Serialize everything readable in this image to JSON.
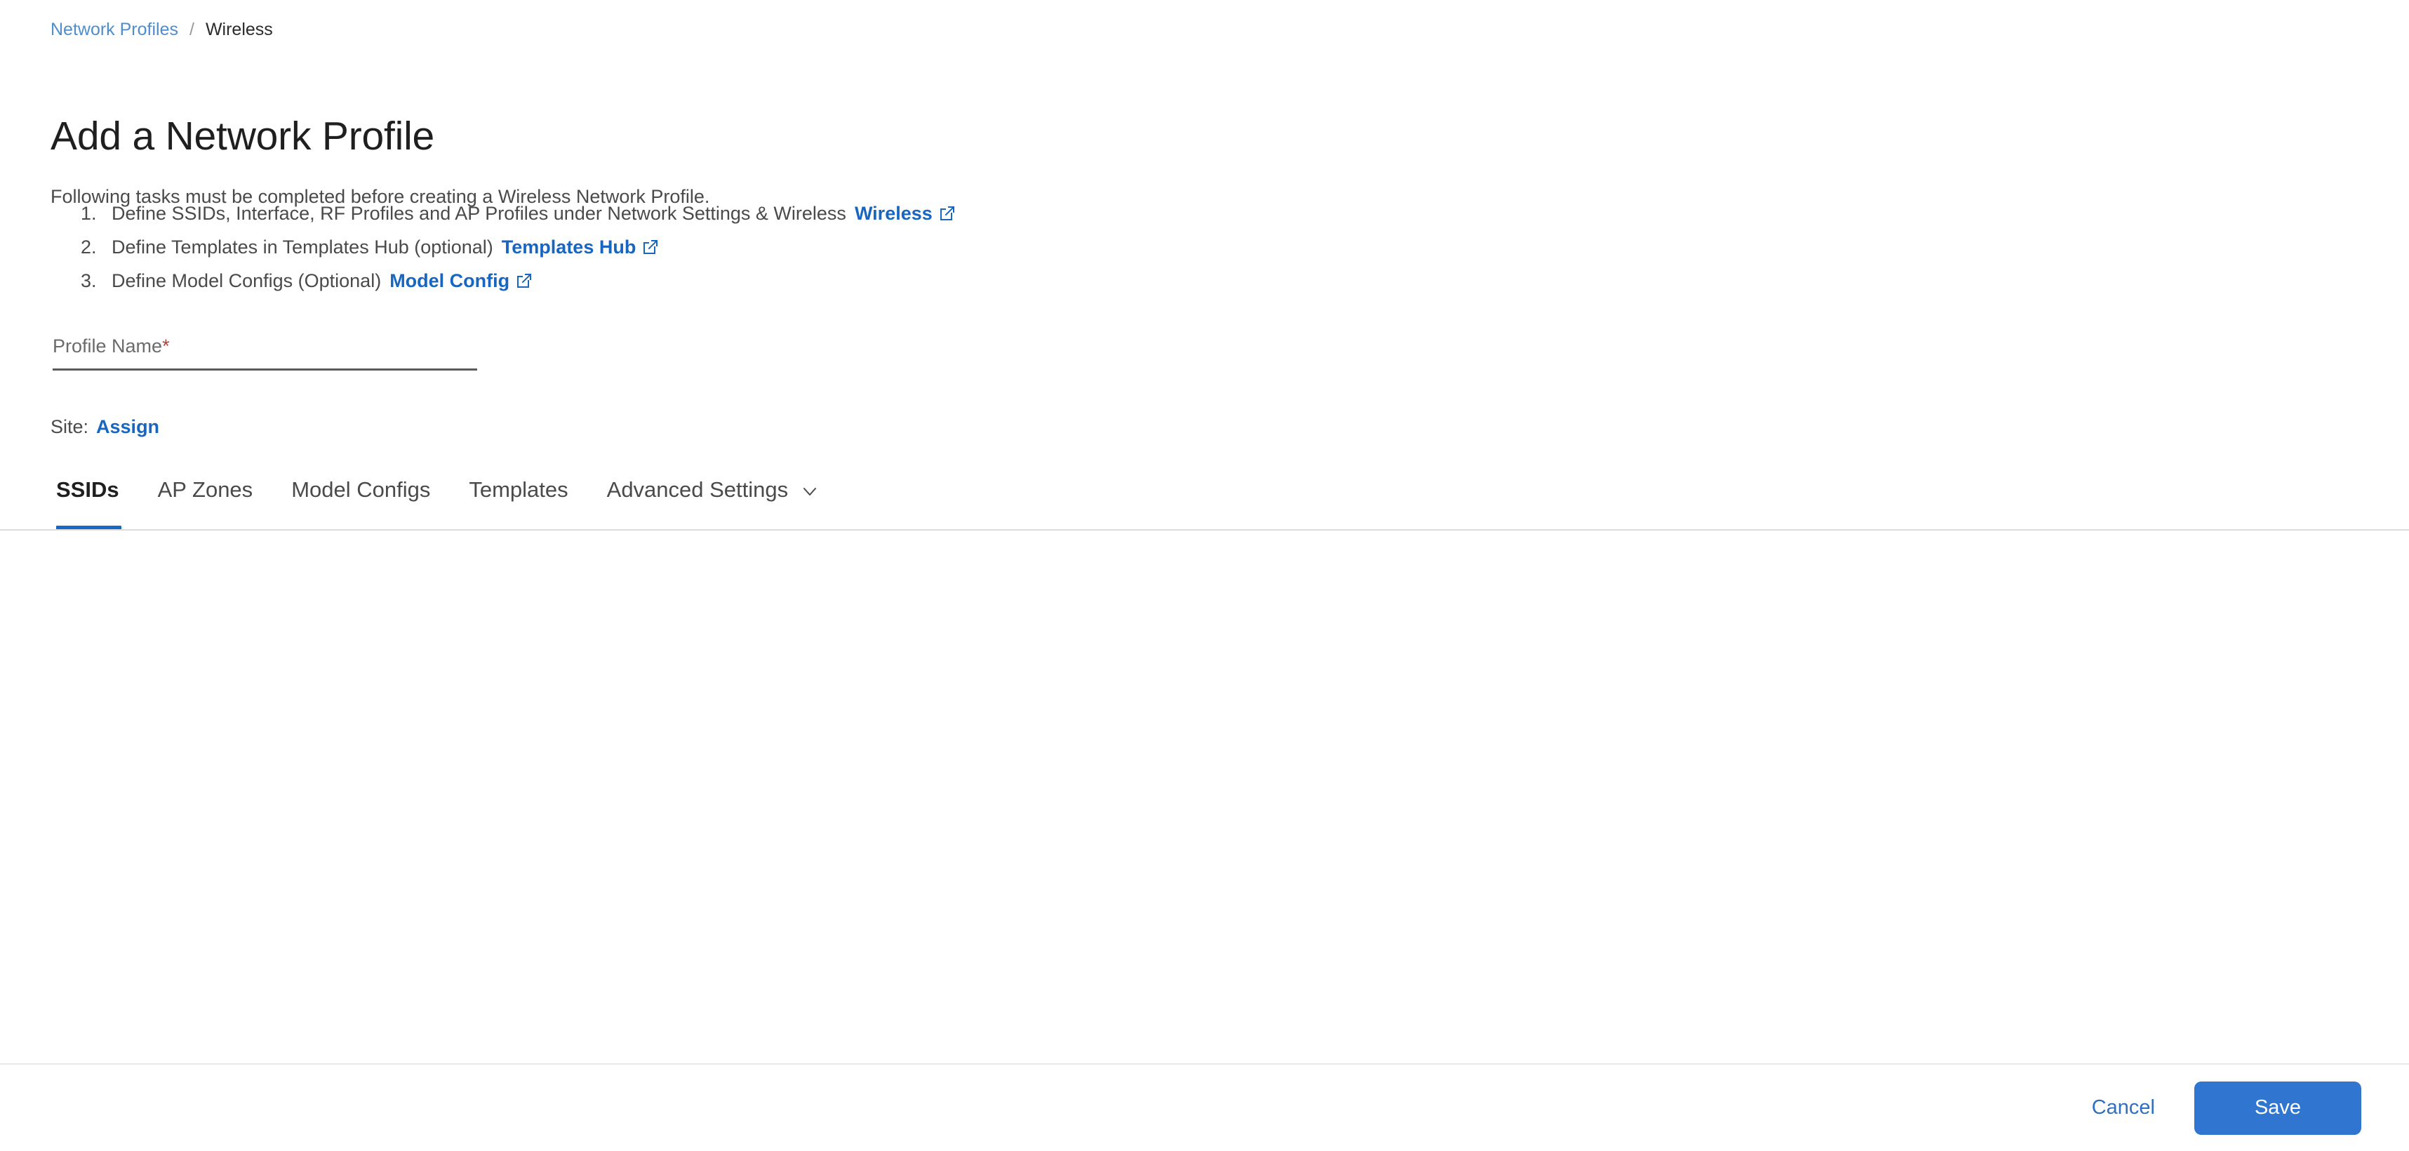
{
  "breadcrumb": {
    "parent": "Network Profiles",
    "separator": "/",
    "current": "Wireless"
  },
  "page": {
    "title": "Add a Network Profile",
    "intro": "Following tasks must be completed before creating a Wireless Network Profile."
  },
  "tasks": [
    {
      "number": "1.",
      "text": "Define SSIDs, Interface, RF Profiles and AP Profiles under Network Settings & Wireless",
      "link": "Wireless",
      "icon": "external-link-icon"
    },
    {
      "number": "2.",
      "text": "Define Templates in Templates Hub (optional)",
      "link": "Templates Hub",
      "icon": "external-link-icon"
    },
    {
      "number": "3.",
      "text": "Define Model Configs (Optional)",
      "link": "Model Config",
      "icon": "external-link-icon"
    }
  ],
  "profile_name_field": {
    "label": "Profile Name",
    "required_marker": "*",
    "value": "",
    "placeholder": ""
  },
  "site": {
    "label": "Site:",
    "assign_link": "Assign"
  },
  "tabs": {
    "items": [
      {
        "label": "SSIDs",
        "active": true
      },
      {
        "label": "AP Zones",
        "active": false
      },
      {
        "label": "Model Configs",
        "active": false
      },
      {
        "label": "Templates",
        "active": false
      },
      {
        "label": "Advanced Settings",
        "active": false,
        "icon": "chevron-down-icon"
      }
    ],
    "active_index": 0
  },
  "footer": {
    "cancel_label": "Cancel",
    "save_label": "Save"
  },
  "colors": {
    "link_blue": "#1866c0",
    "breadcrumb_blue": "#4e8ecc",
    "accent_blue": "#1668c7",
    "save_button_blue": "#3076d1",
    "required_red": "#b3433c",
    "text_gray": "#4a4a4a",
    "divider_gray": "#dcdcdc"
  }
}
